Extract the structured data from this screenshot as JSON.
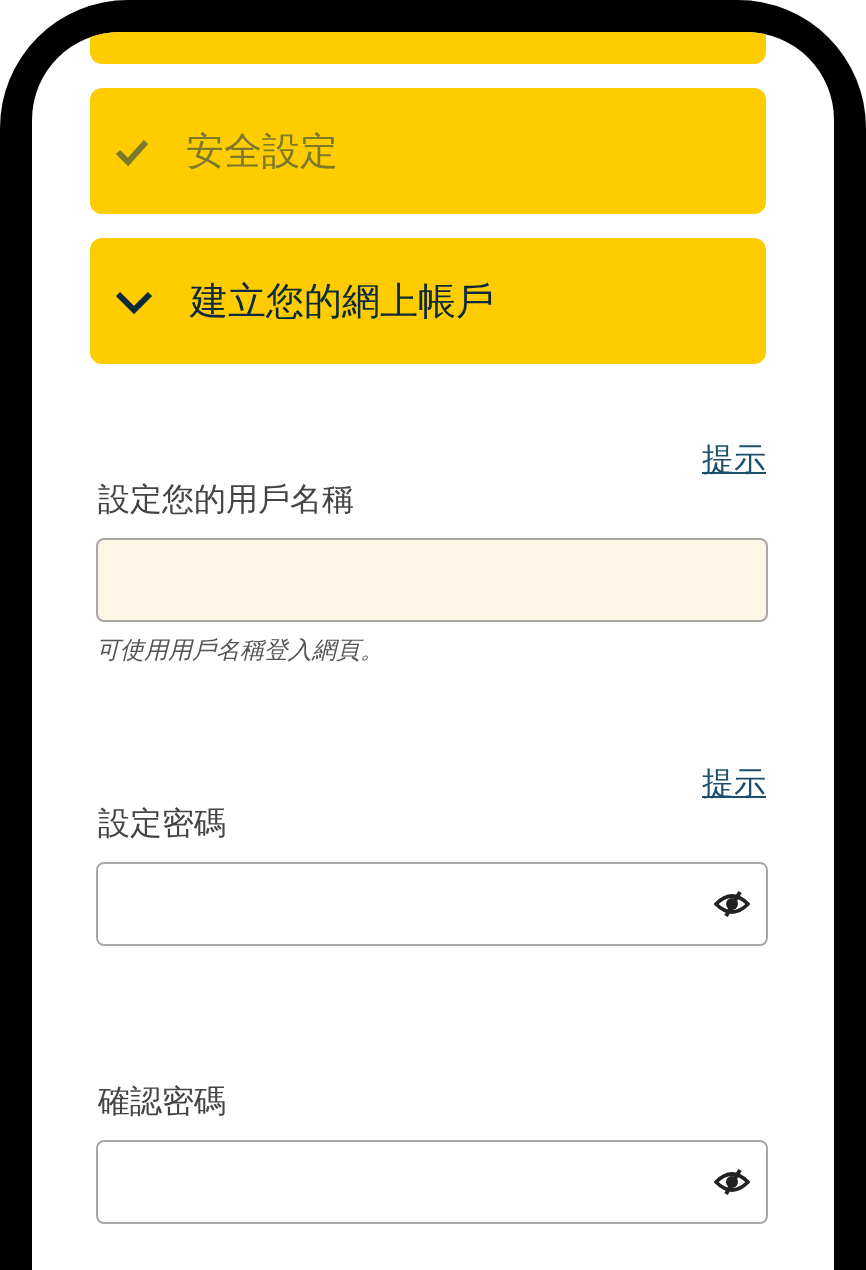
{
  "steps": [
    {
      "title": "安全設定",
      "completed": true,
      "expanded": false
    },
    {
      "title": "建立您的網上帳戶",
      "completed": false,
      "expanded": true
    }
  ],
  "fields": [
    {
      "kind": "text",
      "hint": "提示",
      "label": "設定您的用戶名稱",
      "highlighted": true,
      "helper": "可使用用戶名稱登入網頁。"
    },
    {
      "kind": "password",
      "hint": "提示",
      "label": "設定密碼",
      "highlighted": false
    },
    {
      "kind": "password",
      "label": "確認密碼",
      "highlighted": false
    }
  ]
}
